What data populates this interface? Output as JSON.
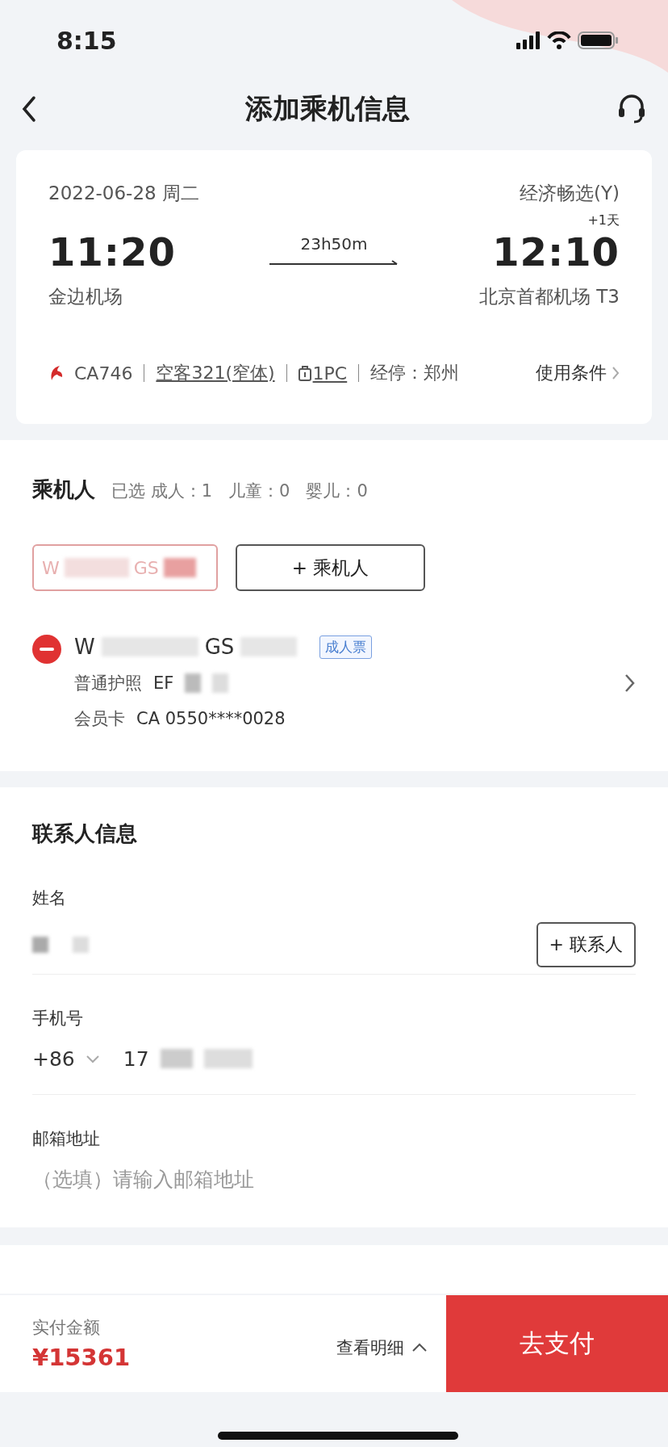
{
  "status_bar": {
    "time": "8:15"
  },
  "header": {
    "title": "添加乘机信息"
  },
  "flight": {
    "date": "2022-06-28 周二",
    "cabin": "经济畅选(Y)",
    "depart_time": "11:20",
    "duration": "23h50m",
    "day_offset": "+1天",
    "arrive_time": "12:10",
    "depart_airport": "金边机场",
    "arrive_airport": "北京首都机场 T3",
    "flight_no": "CA746",
    "aircraft": "空客321(窄体)",
    "baggage": "1PC",
    "stopover": "经停：郑州",
    "conditions": "使用条件"
  },
  "passengers": {
    "title": "乘机人",
    "summary": "已选 成人：1   儿童：0   婴儿：0",
    "chips": [
      {
        "name_parts": [
          "W",
          "GS"
        ],
        "selected": true
      }
    ],
    "add_button": "+ 乘机人",
    "list": [
      {
        "name_parts": [
          "W",
          "GS"
        ],
        "ticket_type": "成人票",
        "id_label": "普通护照",
        "id_value": "EF",
        "card_label": "会员卡",
        "card_value": "CA 0550****0028"
      }
    ]
  },
  "contact": {
    "title": "联系人信息",
    "fields": [
      {
        "kind": "name",
        "label": "姓名",
        "button": "+ 联系人"
      },
      {
        "kind": "phone",
        "label": "手机号",
        "country_code": "+86",
        "value": "17"
      },
      {
        "kind": "email",
        "label": "邮箱地址",
        "placeholder": "（选填）请输入邮箱地址"
      }
    ]
  },
  "pay_bar": {
    "label": "实付金额",
    "amount": "¥15361",
    "details": "查看明细",
    "pay_button": "去支付"
  }
}
